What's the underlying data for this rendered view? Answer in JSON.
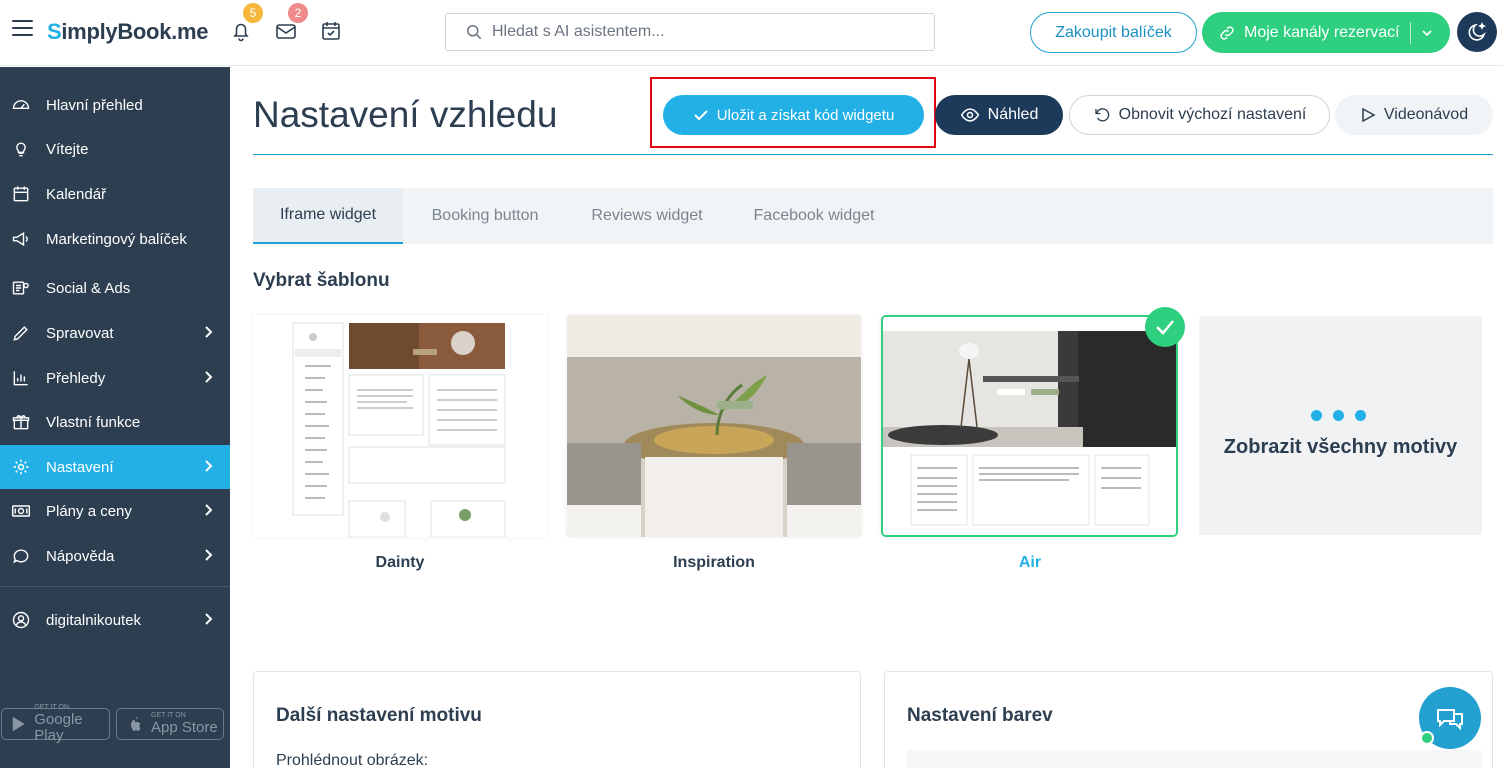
{
  "header": {
    "logo_prefix": "S",
    "logo_text": "implyBook",
    "logo_suffix": ".me",
    "notifications_count": "5",
    "messages_count": "2",
    "search_placeholder": "Hledat s AI asistentem...",
    "buy_package_label": "Zakoupit balíček",
    "channels_label": "Moje kanály rezervací"
  },
  "sidebar": {
    "items": [
      {
        "label": "Hlavní přehled",
        "icon": "dashboard-icon"
      },
      {
        "label": "Vítejte",
        "icon": "lightbulb-icon"
      },
      {
        "label": "Kalendář",
        "icon": "calendar-icon"
      },
      {
        "label": "Marketingový balíček",
        "icon": "megaphone-icon"
      },
      {
        "label": "Social & Ads",
        "icon": "social-ads-icon"
      },
      {
        "label": "Spravovat",
        "icon": "pencil-icon"
      },
      {
        "label": "Přehledy",
        "icon": "bar-chart-icon"
      },
      {
        "label": "Vlastní funkce",
        "icon": "gift-icon"
      },
      {
        "label": "Nastavení",
        "icon": "gear-icon"
      },
      {
        "label": "Plány a ceny",
        "icon": "money-icon"
      },
      {
        "label": "Nápověda",
        "icon": "chat-icon"
      },
      {
        "label": "digitalnikoutek",
        "icon": "user-icon"
      }
    ],
    "google_play_small": "GET IT ON",
    "google_play_big": "Google Play",
    "app_store_small": "GET IT ON",
    "app_store_big": "App Store"
  },
  "main": {
    "title": "Nastavení vzhledu",
    "save_label": "Uložit a získat kód widgetu",
    "preview_label": "Náhled",
    "reset_label": "Obnovit výchozí nastavení",
    "video_label": "Videonávod",
    "tabs": [
      "Iframe widget",
      "Booking button",
      "Reviews widget",
      "Facebook widget"
    ],
    "active_tab": "Iframe widget",
    "template_section_title": "Vybrat šablonu",
    "themes": [
      {
        "name": "Dainty",
        "selected": false
      },
      {
        "name": "Inspiration",
        "selected": false
      },
      {
        "name": "Air",
        "selected": true
      }
    ],
    "show_all_themes_label": "Zobrazit všechny motivy",
    "more_settings_title": "Další nastavení motivu",
    "preview_image_label": "Prohlédnout obrázek:",
    "color_settings_title": "Nastavení barev"
  },
  "colors": {
    "accent_blue": "#22b0e6",
    "navy": "#1e3a5a",
    "sidebar_bg": "#2c3e50",
    "green": "#2ecf7f",
    "highlight_red": "#e30613"
  }
}
